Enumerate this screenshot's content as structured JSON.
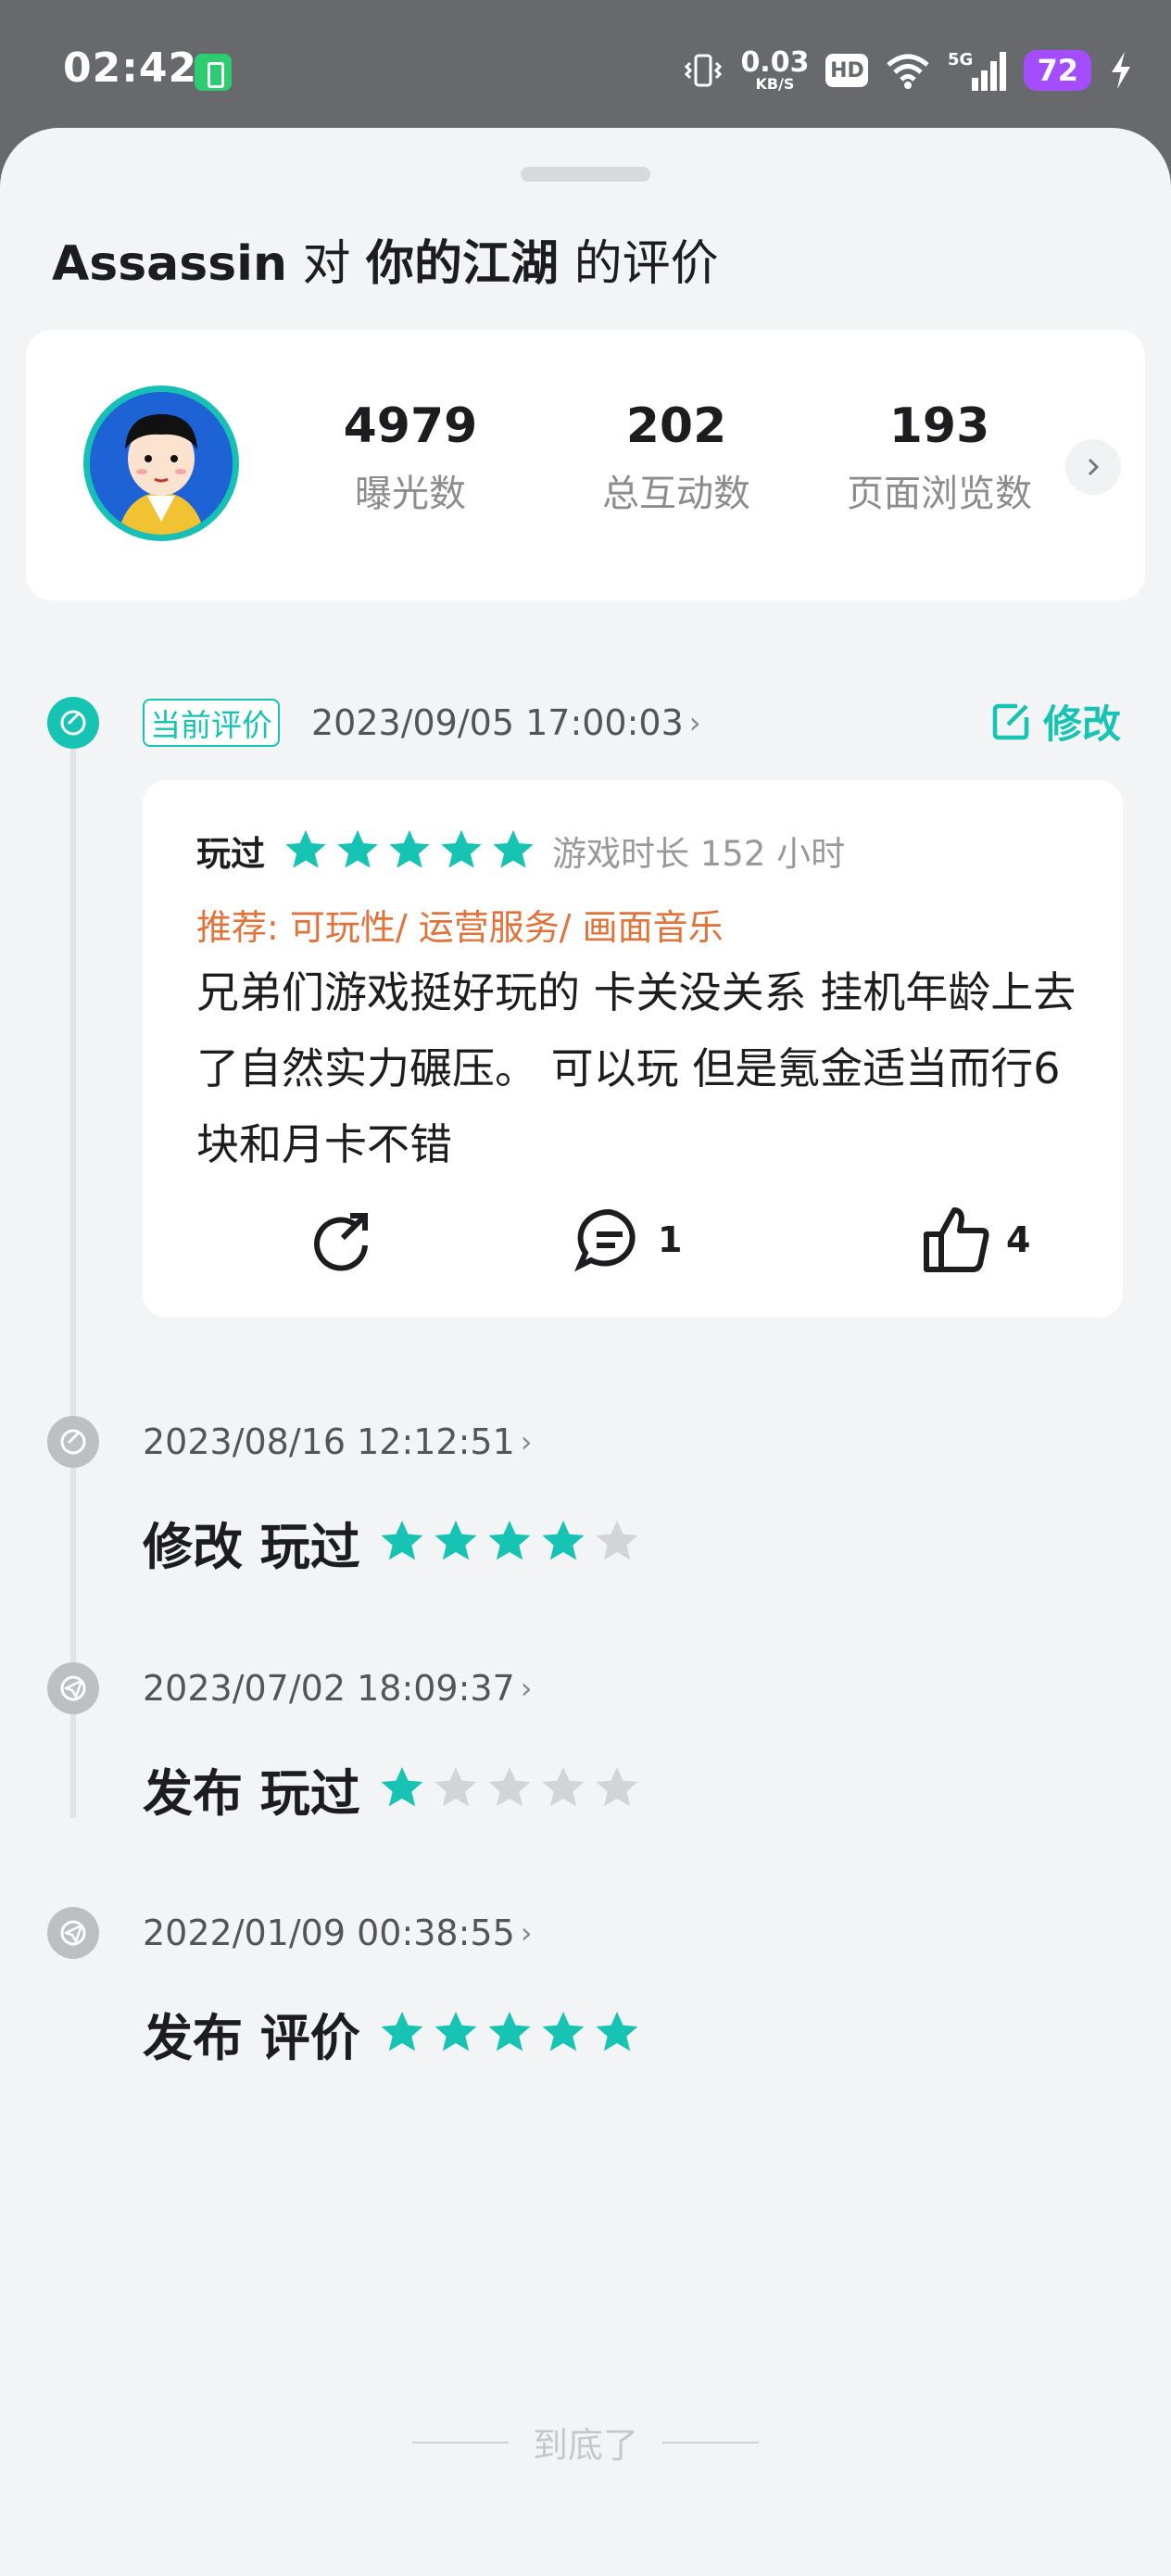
{
  "status_bar": {
    "time": "02:42",
    "speed_value": "0.03",
    "speed_unit": "KB/S",
    "hd_label": "HD",
    "network_label": "5G",
    "battery_level": "72"
  },
  "sheet": {
    "title_user": "Assassin",
    "title_mid": " 对 ",
    "title_game": "你的江湖",
    "title_end": " 的评价"
  },
  "stats": [
    {
      "value": "4979",
      "label": "曝光数"
    },
    {
      "value": "202",
      "label": "总互动数"
    },
    {
      "value": "193",
      "label": "页面浏览数"
    }
  ],
  "current_review": {
    "badge": "当前评价",
    "date": "2023/09/05 17:00:03",
    "edit_label": "修改",
    "played_label": "玩过",
    "rating": 5,
    "playtime": "游戏时长 152 小时",
    "recommend": "推荐: 可玩性/ 运营服务/ 画面音乐",
    "body": "兄弟们游戏挺好玩的 卡关没关系 挂机年龄上去了自然实力碾压。 可以玩 但是氪金适当而行6块和月卡不错",
    "comment_count": "1",
    "like_count": "4"
  },
  "history": [
    {
      "date": "2023/08/16 12:12:51",
      "action": "修改 玩过",
      "rating": 4,
      "icon": "edit-check-icon"
    },
    {
      "date": "2023/07/02 18:09:37",
      "action": "发布 玩过",
      "rating": 1,
      "icon": "paper-plane-icon"
    },
    {
      "date": "2022/01/09 00:38:55",
      "action": "发布 评价",
      "rating": 5,
      "icon": "paper-plane-icon"
    }
  ],
  "footer": {
    "end_label": "到底了"
  },
  "colors": {
    "accent": "#17c3b2",
    "star_off": "#d3d4d7",
    "recommend": "#e0723a",
    "avatar_bg": "#1e63d6"
  }
}
